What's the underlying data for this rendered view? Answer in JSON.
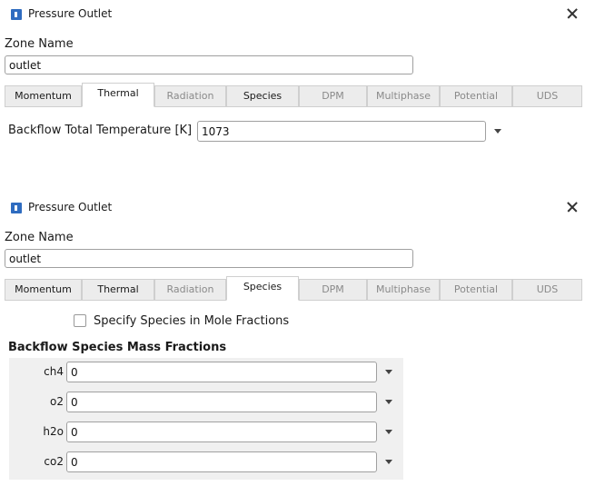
{
  "dialog_title": "Pressure Outlet",
  "zone_name_label": "Zone Name",
  "zone_name_value": "outlet",
  "tabs": [
    "Momentum",
    "Thermal",
    "Radiation",
    "Species",
    "DPM",
    "Multiphase",
    "Potential",
    "UDS"
  ],
  "panel1": {
    "active_tab": "Thermal",
    "backflow_temp_label": "Backflow Total Temperature [K]",
    "backflow_temp_value": "1073"
  },
  "panel2": {
    "active_tab": "Species",
    "mole_fraction_checkbox_label": "Specify Species in Mole Fractions",
    "mole_fraction_checked": false,
    "section_heading": "Backflow Species Mass Fractions",
    "species": [
      {
        "name": "ch4",
        "value": "0"
      },
      {
        "name": "o2",
        "value": "0"
      },
      {
        "name": "h2o",
        "value": "0"
      },
      {
        "name": "co2",
        "value": "0"
      }
    ]
  },
  "icons": {
    "app": "fluent-app-icon",
    "close": "close-icon",
    "dropdown": "dropdown-arrow-icon"
  }
}
